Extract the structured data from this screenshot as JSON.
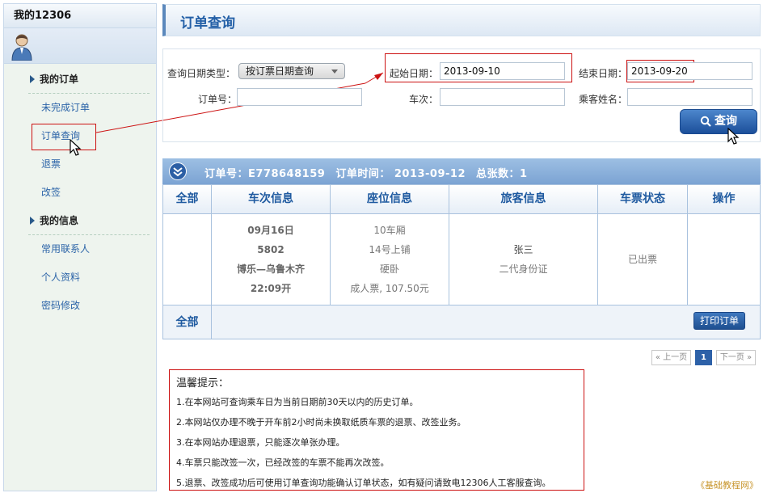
{
  "sidebar": {
    "title": "我的12306",
    "sections": [
      {
        "label": "我的订单",
        "items": [
          "未完成订单",
          "订单查询",
          "退票",
          "改签"
        ]
      },
      {
        "label": "我的信息",
        "items": [
          "常用联系人",
          "个人资料",
          "密码修改"
        ]
      }
    ]
  },
  "main": {
    "title": "订单查询",
    "search": {
      "date_type_label": "查询日期类型：",
      "date_type_value": "按订票日期查询",
      "start_label": "起始日期：",
      "start_value": "2013-09-10",
      "end_label": "结束日期：",
      "end_value": "2013-09-20",
      "order_no_label": "订单号：",
      "train_label": "车次：",
      "passenger_label": "乘客姓名：",
      "button_label": "查询"
    },
    "order": {
      "order_no": "订单号：E778648159",
      "order_time": "订单时间：  2013-09-12",
      "total": "总张数：1",
      "headers": [
        "全部",
        "车次信息",
        "座位信息",
        "旅客信息",
        "车票状态",
        "操作"
      ],
      "train": [
        "09月16日",
        "5802",
        "博乐—乌鲁木齐",
        "22:09开"
      ],
      "seat": [
        "10车厢",
        "14号上铺",
        "硬卧",
        "成人票, 107.50元"
      ],
      "passenger": [
        "张三",
        "二代身份证"
      ],
      "status": "已出票",
      "footer_all": "全部",
      "print_label": "打印订单"
    },
    "pagination": {
      "prev": "« 上一页",
      "current": "1",
      "next": "下一页 »"
    },
    "notice": {
      "title": "温馨提示：",
      "lines": [
        "1.在本网站可查询乘车日为当前日期前30天以内的历史订单。",
        "2.本网站仅办理不晚于开车前2小时尚未换取纸质车票的退票、改签业务。",
        "3.在本网站办理退票，只能逐次单张办理。",
        "4.车票只能改签一次，已经改签的车票不能再次改签。",
        "5.退票、改签成功后可使用订单查询功能确认订单状态，如有疑问请致电12306人工客服查询。"
      ]
    }
  },
  "watermark": "《基础教程网》",
  "colors": {
    "accent": "#2460a7",
    "highlight": "#cc1111",
    "sidebar_bg": "#eef4ee"
  }
}
